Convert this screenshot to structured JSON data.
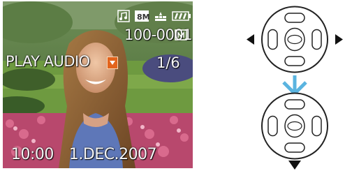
{
  "screen": {
    "file_number": "100-0001",
    "play_mode": "PLAY AUDIO",
    "count": "1/6",
    "time": "10:00",
    "date": "1.DEC.2007",
    "picture_size": "8M",
    "icons": {
      "audio": "audio-note-icon",
      "size": "picture-size-8m-icon",
      "quality": "quality-fine-icon",
      "battery": "battery-icon",
      "card": "memory-card-icon",
      "play_marker": "play-audio-arrow-icon"
    }
  },
  "diagram": {
    "steps": [
      {
        "name": "step-1-pad",
        "pressed": "left/right"
      },
      {
        "name": "step-2-pad",
        "pressed": "down"
      }
    ],
    "colors": {
      "arrow": "#5ab4e0",
      "pad_outline": "#222222",
      "highlight_triangle": "#111111"
    }
  }
}
